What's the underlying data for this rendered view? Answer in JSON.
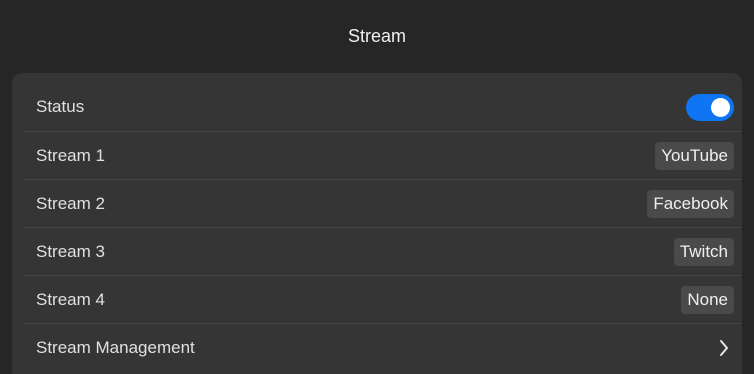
{
  "header": {
    "title": "Stream"
  },
  "settings": {
    "status": {
      "label": "Status",
      "toggle_on": true,
      "accent": "#0f75f2"
    },
    "streams": [
      {
        "label": "Stream 1",
        "value": "YouTube"
      },
      {
        "label": "Stream 2",
        "value": "Facebook"
      },
      {
        "label": "Stream 3",
        "value": "Twitch"
      },
      {
        "label": "Stream 4",
        "value": "None"
      }
    ],
    "management": {
      "label": "Stream Management",
      "icon": "chevron-right-icon"
    }
  }
}
